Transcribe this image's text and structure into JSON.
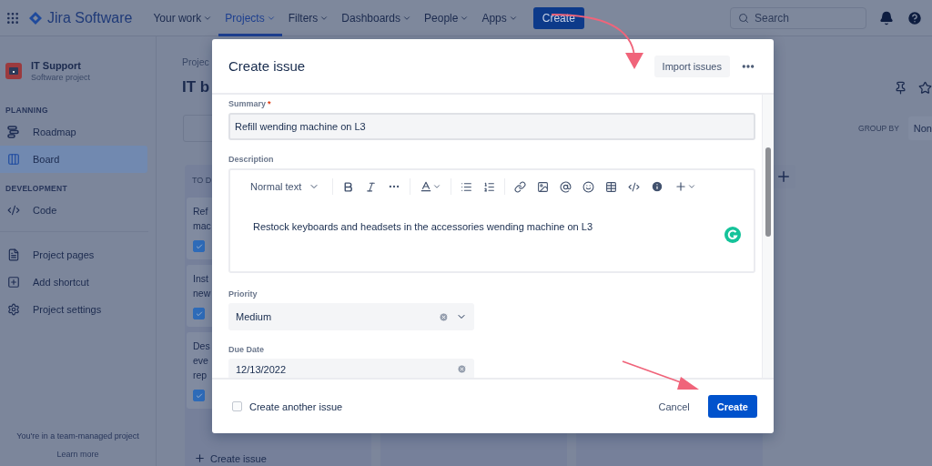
{
  "top_nav": {
    "product": "Jira Software",
    "items": [
      {
        "label": "Your work",
        "selected": false
      },
      {
        "label": "Projects",
        "selected": true
      },
      {
        "label": "Filters",
        "selected": false
      },
      {
        "label": "Dashboards",
        "selected": false
      },
      {
        "label": "People",
        "selected": false
      },
      {
        "label": "Apps",
        "selected": false
      }
    ],
    "create_button": "Create",
    "search": {
      "placeholder": "Search"
    }
  },
  "sidebar": {
    "project": {
      "name": "IT Support",
      "type": "Software project"
    },
    "sections": [
      {
        "heading": "PLANNING",
        "items": [
          {
            "label": "Roadmap",
            "kind": "roadmap",
            "selected": false
          },
          {
            "label": "Board",
            "kind": "board",
            "selected": true
          }
        ]
      },
      {
        "heading": "DEVELOPMENT",
        "items": [
          {
            "label": "Code",
            "kind": "code",
            "selected": false
          }
        ]
      }
    ],
    "links": [
      {
        "label": "Project pages",
        "kind": "pages"
      },
      {
        "label": "Add shortcut",
        "kind": "shortcut"
      },
      {
        "label": "Project settings",
        "kind": "settings"
      }
    ],
    "footer": {
      "note": "You're in a team-managed project",
      "link": "Learn more"
    }
  },
  "board": {
    "breadcrumb": "Projec",
    "title": "IT b",
    "group_by": {
      "label": "GROUP BY",
      "value": "Non"
    },
    "column": {
      "heading": "TO D",
      "cards": [
        {
          "lines": [
            "Ref",
            "mac"
          ],
          "checked": true
        },
        {
          "lines": [
            "Inst",
            "new"
          ],
          "checked": true
        },
        {
          "lines": [
            "Des",
            "eve",
            "rep"
          ],
          "checked": true
        }
      ]
    },
    "create_issue": "Create issue"
  },
  "modal": {
    "title": "Create issue",
    "import_button": "Import issues",
    "fields": [
      {
        "kind": "text",
        "label": "Summary",
        "required_mark": "*",
        "value": "Refill wending machine on L3"
      },
      {
        "kind": "editor",
        "label": "Description",
        "text_style": "Normal text",
        "value": "Restock keyboards and headsets in the accessories wending machine on L3"
      },
      {
        "kind": "select",
        "label": "Priority",
        "value": "Medium"
      },
      {
        "kind": "date",
        "label": "Due Date",
        "value": "12/13/2022"
      }
    ],
    "create_another": {
      "label": "Create another issue",
      "checked": false
    },
    "buttons": [
      {
        "label": "Cancel",
        "kind": "subtle"
      },
      {
        "label": "Create",
        "kind": "primary"
      }
    ]
  }
}
